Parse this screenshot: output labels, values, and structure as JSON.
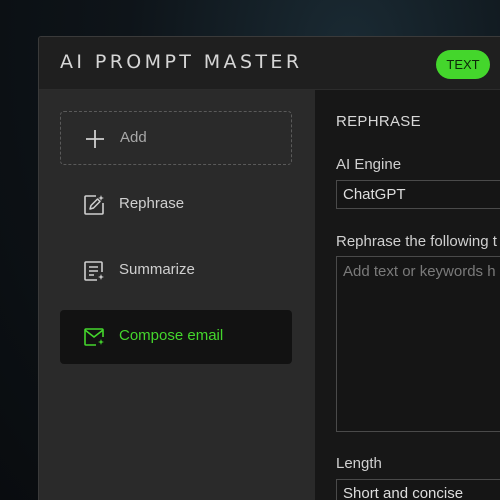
{
  "app": {
    "title": "AI PROMPT MASTER",
    "mode_badge": "TEXT"
  },
  "colors": {
    "accent": "#44d62c",
    "sidebar_bg": "#2a2a2a",
    "main_bg": "#171717"
  },
  "sidebar": {
    "items": [
      {
        "label": "Add",
        "icon": "plus-icon"
      },
      {
        "label": "Rephrase",
        "icon": "edit-sparkle-icon"
      },
      {
        "label": "Summarize",
        "icon": "document-sparkle-icon"
      },
      {
        "label": "Compose email",
        "icon": "mail-sparkle-icon",
        "active": true
      }
    ]
  },
  "main": {
    "section_title": "REPHRASE",
    "engine_label": "AI Engine",
    "engine_value": "ChatGPT",
    "prompt_label": "Rephrase the following t",
    "prompt_placeholder": "Add text or keywords h",
    "length_label": "Length",
    "length_value": "Short and concise"
  }
}
